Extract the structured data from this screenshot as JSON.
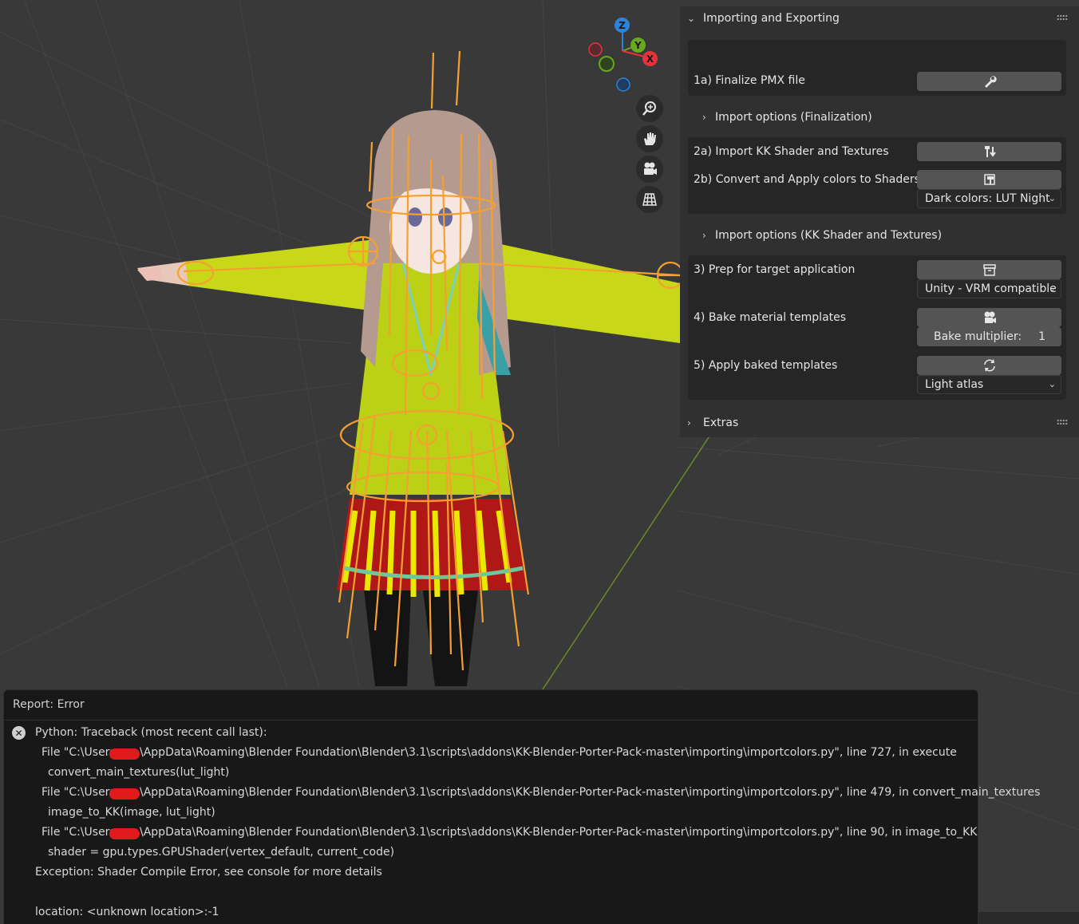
{
  "panel": {
    "importing_header": "Importing and Exporting",
    "finalize_label": "1a) Finalize PMX file",
    "import_options_finalization": "Import options (Finalization)",
    "import_kk_shader_label": "2a) Import KK Shader and Textures",
    "convert_colors_label": "2b) Convert and Apply colors to Shaders",
    "dark_colors_dropdown": "Dark colors: LUT Night",
    "import_options_kk_shader": "Import options (KK Shader and Textures)",
    "prep_target_label": "3) Prep for target application",
    "target_dropdown": "Unity - VRM compatible",
    "bake_templates_label": "4) Bake material templates",
    "bake_multiplier_label": "Bake multiplier:",
    "bake_multiplier_value": "1",
    "apply_baked_label": "5) Apply baked templates",
    "atlas_dropdown": "Light atlas",
    "extras_header": "Extras"
  },
  "gizmo": {
    "z": "Z",
    "y": "Y",
    "x": "X"
  },
  "icons": {
    "finalize": "wrench-icon",
    "import_shader": "brush-import-icon",
    "convert_colors": "paint-bucket-icon",
    "prep": "archive-icon",
    "bake": "camera-icon",
    "apply_baked": "refresh-icon",
    "nav": [
      "zoom-icon",
      "hand-pan-icon",
      "camera-view-icon",
      "grid-ortho-icon"
    ]
  },
  "report": {
    "title": "Report: Error",
    "lines": [
      "Python: Traceback (most recent call last):",
      "File \"C:\\Users",
      "\\AppData\\Roaming\\Blender Foundation\\Blender\\3.1\\scripts\\addons\\KK-Blender-Porter-Pack-master\\importing\\importcolors.py\", line 727, in execute",
      "convert_main_textures(lut_light)",
      "\\AppData\\Roaming\\Blender Foundation\\Blender\\3.1\\scripts\\addons\\KK-Blender-Porter-Pack-master\\importing\\importcolors.py\", line 479, in convert_main_textures",
      "image_to_KK(image, lut_light)",
      "\\AppData\\Roaming\\Blender Foundation\\Blender\\3.1\\scripts\\addons\\KK-Blender-Porter-Pack-master\\importing\\importcolors.py\", line 90, in image_to_KK",
      "shader = gpu.types.GPUShader(vertex_default, current_code)",
      "Exception: Shader Compile Error, see console for more details",
      "location: <unknown location>:-1"
    ]
  },
  "colors": {
    "viewport_bg": "#393939",
    "panel_bg": "#303030",
    "box_bg": "#262626",
    "button": "#545454",
    "bone_orange": "#f5a030",
    "jacket_yellow": "#c8d818",
    "skirt_red": "#b01818",
    "gizmo_x": "#e8323a",
    "gizmo_y": "#6aa820",
    "gizmo_z": "#2f83d6"
  }
}
